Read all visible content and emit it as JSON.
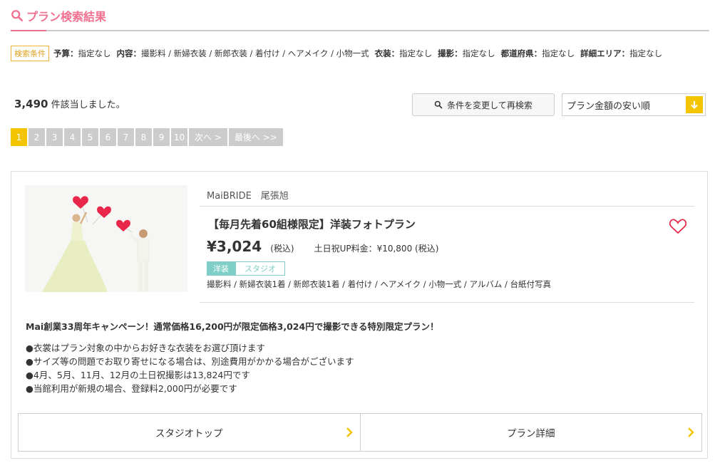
{
  "header": {
    "title": "プラン検索結果"
  },
  "conditions": {
    "tag": "検索条件",
    "items": [
      {
        "key": "予算：",
        "value": "指定なし"
      },
      {
        "key": "内容：",
        "value": "撮影料 / 新婦衣装 / 新郎衣装 / 着付け / ヘアメイク / 小物一式"
      },
      {
        "key": "衣装：",
        "value": "指定なし"
      },
      {
        "key": "撮影：",
        "value": "指定なし"
      },
      {
        "key": "都道府県：",
        "value": "指定なし"
      },
      {
        "key": "詳細エリア：",
        "value": "指定なし"
      }
    ]
  },
  "results": {
    "count": "3,490",
    "count_suffix": "件該当しました。",
    "research_label": "条件を変更して再検索",
    "sort_value": "プラン金額の安い順"
  },
  "pagination": {
    "pages": [
      "1",
      "2",
      "3",
      "4",
      "5",
      "6",
      "7",
      "8",
      "9",
      "10"
    ],
    "next": "次へ >",
    "last": "最後へ >>"
  },
  "plan": {
    "studio": "MaiBRIDE　尾張旭",
    "name": "【毎月先着60組様限定】洋装フォトプラン",
    "price": "¥3,024",
    "tax": "(税込)",
    "holiday": "土日祝UP料金：¥10,800 (税込)",
    "badge_style": "洋装",
    "badge_type": "スタジオ",
    "contents": "撮影料 / 新婦衣装1着 / 新郎衣装1着 / 着付け / ヘアメイク / 小物一式 / アルバム / 台紙付写真",
    "campaign": "Mai創業33周年キャンペーン！通常価格16,200円が限定価格3,024円で撮影できる特別限定プラン！",
    "notes": [
      "●衣裳はプラン対象の中からお好きな衣装をお選び頂けます",
      "●サイズ等の問題でお取り寄せになる場合は、別途費用がかかる場合がございます",
      "●4月、5月、11月、12月の土日祝撮影は13,824円です",
      "●当館利用が新規の場合、登録料2,000円が必要です"
    ],
    "btn_studio": "スタジオトップ",
    "btn_detail": "プラン詳細"
  },
  "colors": {
    "accent": "#f07090",
    "yellow": "#f5c400",
    "teal": "#7fcfc8"
  }
}
